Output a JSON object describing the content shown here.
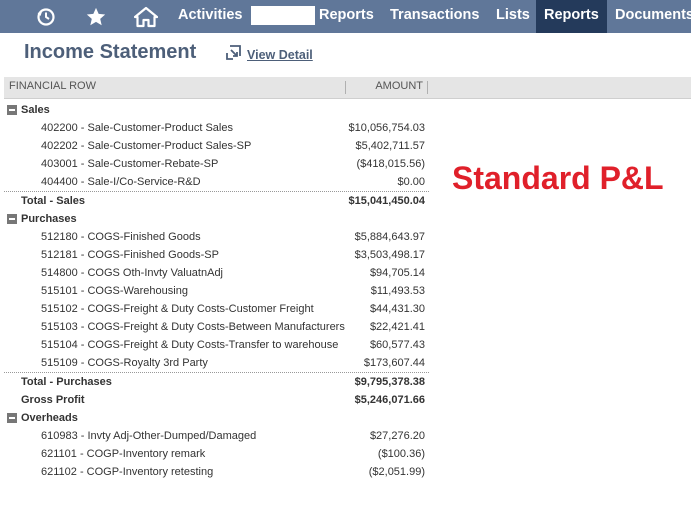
{
  "nav": {
    "items": [
      {
        "label": "Activities"
      },
      {
        "label": "Reports"
      },
      {
        "label": "Transactions"
      },
      {
        "label": "Lists"
      },
      {
        "label": "Reports"
      },
      {
        "label": "Documents"
      }
    ]
  },
  "page": {
    "title": "Income Statement",
    "view_detail_label": "View Detail"
  },
  "table": {
    "headers": {
      "financial_row": "FINANCIAL ROW",
      "amount": "AMOUNT"
    },
    "sections": [
      {
        "name": "Sales",
        "rows": [
          {
            "label": "402200 - Sale-Customer-Product Sales",
            "amount": "$10,056,754.03"
          },
          {
            "label": "402202 - Sale-Customer-Product Sales-SP",
            "amount": "$5,402,711.57"
          },
          {
            "label": "403001 - Sale-Customer-Rebate-SP",
            "amount": "($418,015.56)"
          },
          {
            "label": "404400 - Sale-I/Co-Service-R&D",
            "amount": "$0.00"
          }
        ],
        "total": {
          "label": "Total - Sales",
          "amount": "$15,041,450.04"
        }
      },
      {
        "name": "Purchases",
        "rows": [
          {
            "label": "512180 - COGS-Finished Goods",
            "amount": "$5,884,643.97"
          },
          {
            "label": "512181 - COGS-Finished Goods-SP",
            "amount": "$3,503,498.17"
          },
          {
            "label": "514800 - COGS Oth-Invty ValuatnAdj",
            "amount": "$94,705.14"
          },
          {
            "label": "515101 - COGS-Warehousing",
            "amount": "$11,493.53"
          },
          {
            "label": "515102 - COGS-Freight & Duty Costs-Customer Freight",
            "amount": "$44,431.30"
          },
          {
            "label": "515103 - COGS-Freight & Duty Costs-Between Manufacturers",
            "amount": "$22,421.41"
          },
          {
            "label": "515104 - COGS-Freight & Duty Costs-Transfer to warehouse",
            "amount": "$60,577.43"
          },
          {
            "label": "515109 - COGS-Royalty 3rd Party",
            "amount": "$173,607.44"
          }
        ],
        "total": {
          "label": "Total - Purchases",
          "amount": "$9,795,378.38"
        }
      }
    ],
    "gross_profit": {
      "label": "Gross Profit",
      "amount": "$5,246,071.66"
    },
    "overheads": {
      "name": "Overheads",
      "rows": [
        {
          "label": "610983 - Invty Adj-Other-Dumped/Damaged",
          "amount": "$27,276.20"
        },
        {
          "label": "621101 - COGP-Inventory remark",
          "amount": "($100.36)"
        },
        {
          "label": "621102 - COGP-Inventory retesting",
          "amount": "($2,051.99)"
        }
      ]
    }
  },
  "annotation": {
    "text": "Standard P&L",
    "color": "#e0202a"
  },
  "icons": [
    "recent-records-icon",
    "star-icon",
    "home-icon",
    "view-detail-icon",
    "collapse-icon"
  ],
  "colors": {
    "nav_bg": "#607799",
    "nav_active_bg": "#243a5b",
    "title": "#4d5f79"
  }
}
